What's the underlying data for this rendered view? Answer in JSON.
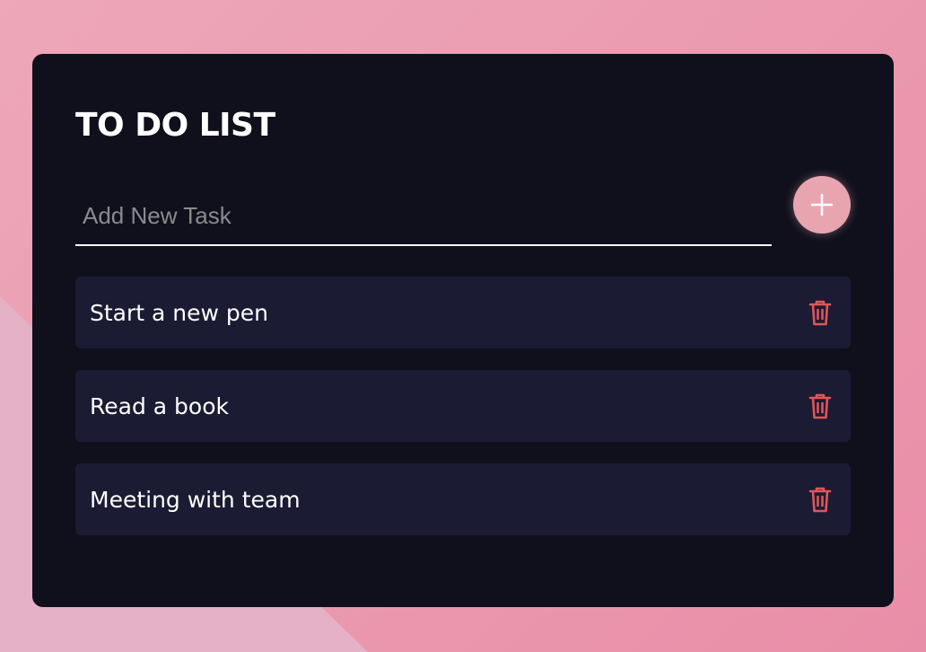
{
  "colors": {
    "card_background": "#10101c",
    "task_background": "#1b1b33",
    "accent": "#e8a5b0",
    "delete_icon": "#e05558",
    "text": "#ffffff",
    "placeholder": "#8a8a8e"
  },
  "todo": {
    "title": "TO DO LIST",
    "input": {
      "placeholder": "Add New Task",
      "value": ""
    },
    "add_button_icon": "plus-icon",
    "tasks": [
      {
        "label": "Start a new pen",
        "action_icon": "trash-icon"
      },
      {
        "label": "Read a book",
        "action_icon": "trash-icon"
      },
      {
        "label": "Meeting with team",
        "action_icon": "trash-icon"
      }
    ]
  }
}
